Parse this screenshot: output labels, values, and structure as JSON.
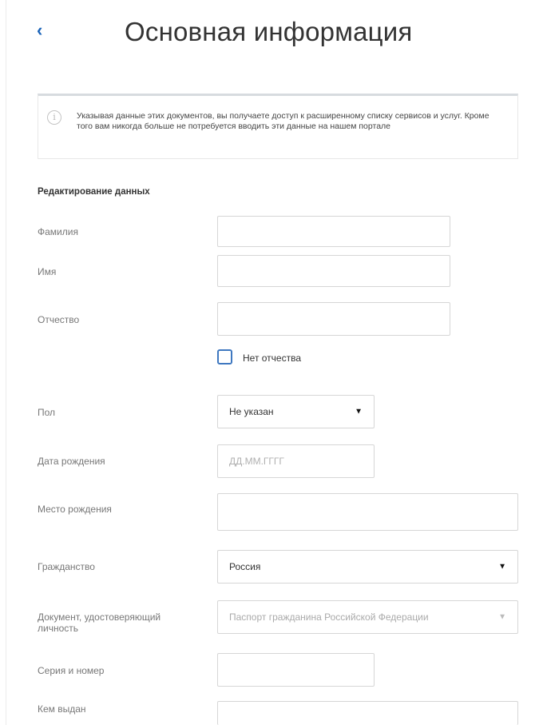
{
  "header": {
    "back_glyph": "‹",
    "title": "Основная информация"
  },
  "info": {
    "icon": "info-circle-icon",
    "icon_glyph": "i",
    "text": "Указывая данные этих документов, вы получаете доступ к расширенному списку сервисов и услуг. Кроме того вам никогда больше не потребуется вводить эти данные на нашем портале"
  },
  "section": {
    "title": "Редактирование данных"
  },
  "form": {
    "surname_label": "Фамилия",
    "surname_value": "",
    "name_label": "Имя",
    "name_value": "",
    "patronymic_label": "Отчество",
    "patronymic_value": "",
    "no_patronymic_label": "Нет отчества",
    "no_patronymic_checked": false,
    "gender_label": "Пол",
    "gender_value": "Не указан",
    "birthdate_label": "Дата рождения",
    "birthdate_placeholder": "ДД.ММ.ГГГГ",
    "birthplace_label": "Место рождения",
    "birthplace_value": "",
    "citizenship_label": "Гражданство",
    "citizenship_value": "Россия",
    "id_doc_label": "Документ, удостоверяющий личность",
    "id_doc_value": "Паспорт гражданина Российской Федерации",
    "series_label": "Серия и номер",
    "series_value": "",
    "issued_by_label": "Кем выдан",
    "issued_by_value": "",
    "dropdown_glyph": "▼"
  },
  "colors": {
    "accent": "#1a63b8",
    "checkbox_border": "#3f78c0",
    "field_border": "#d6d6d6"
  }
}
